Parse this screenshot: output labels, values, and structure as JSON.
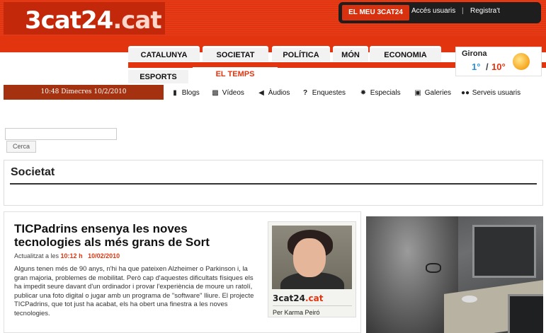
{
  "header": {
    "logo": {
      "brand": "3cat",
      "num": "24",
      "domain": ".cat"
    },
    "user": {
      "elmeu": "EL MEU 3CAT24",
      "acces": "Accés usuaris",
      "sep": "|",
      "registra": "Registra't"
    },
    "tabs": [
      {
        "label": "CATALUNYA"
      },
      {
        "label": "SOCIETAT"
      },
      {
        "label": "POLÍTICA"
      },
      {
        "label": "MÓN"
      },
      {
        "label": "ECONOMIA"
      },
      {
        "label": "ESPORTS"
      },
      {
        "label": "EL TEMPS"
      }
    ],
    "weather": {
      "city": "Girona",
      "min": "1°",
      "sep": "/",
      "max": "10°",
      "icon": "sun-icon"
    }
  },
  "datebar": {
    "text": "10:48 Dimecres 10/2/2010"
  },
  "services": [
    {
      "label": "Blogs",
      "icon": "speech-bubble-icon"
    },
    {
      "label": "Vídeos",
      "icon": "video-camera-icon"
    },
    {
      "label": "Àudios",
      "icon": "speaker-icon"
    },
    {
      "label": "Enquestes",
      "icon": "question-icon"
    },
    {
      "label": "Especials",
      "icon": "star-burst-icon"
    },
    {
      "label": "Galeries",
      "icon": "camera-icon"
    },
    {
      "label": "Serveis usuaris",
      "icon": "users-icon"
    }
  ],
  "search": {
    "placeholder": "",
    "button": "Cerca"
  },
  "section": {
    "title": "Societat"
  },
  "article": {
    "title": "TICPadrins ensenya les noves tecnologies als més grans de Sort",
    "updated_label": "Actualitzat a les",
    "time": "10:12 h",
    "date": "10/02/2010",
    "summary": "Alguns tenen més de 90 anys, n'hi ha que pateixen Alzheimer o Parkinson i, la gran majoria, problemes de mobilitat. Però cap d'aquestes dificultats físiques els ha impedit seure davant d'un ordinador i provar l'experiència de moure un ratolí, publicar una foto digital o jugar amb un programa de \"software\" lliure. El projecte TICPadrins, que tot just ha acabat, els ha obert una finestra a les noves tecnologies.",
    "author_box": {
      "brand": "3cat",
      "num": "24",
      "domain": ".cat",
      "author": "Per Karma Peiró"
    }
  },
  "colors": {
    "accent": "#e2340f",
    "dark": "#1e1e1e",
    "datebar": "#a4310f"
  }
}
